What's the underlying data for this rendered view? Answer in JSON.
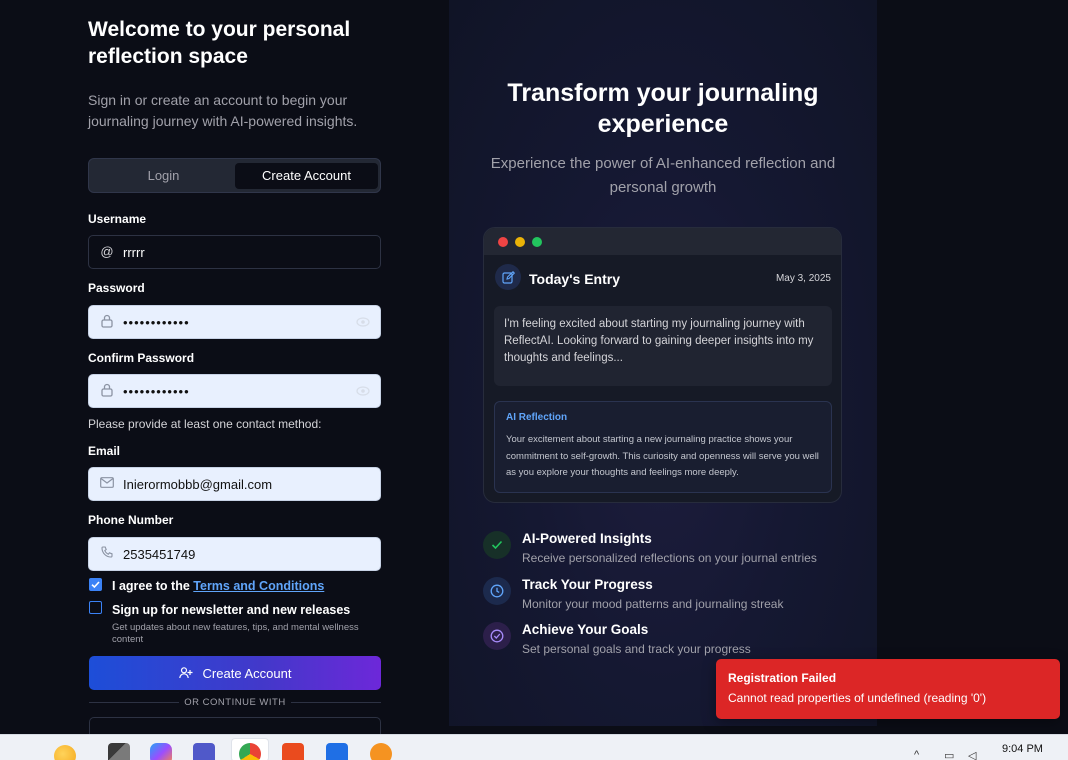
{
  "auth": {
    "welcome_title": "Welcome to your personal reflection space",
    "welcome_subtitle": "Sign in or create an account to begin your journaling journey with AI-powered insights.",
    "tabs": {
      "login": "Login",
      "create": "Create Account"
    },
    "username_label": "Username",
    "username_value": "rrrrr",
    "password_label": "Password",
    "password_value": "••••••••••••",
    "confirm_label": "Confirm Password",
    "confirm_value": "••••••••••••",
    "contact_note": "Please provide at least one contact method:",
    "email_label": "Email",
    "email_value": "Inierormobbb@gmail.com",
    "phone_label": "Phone Number",
    "phone_value": "2535451749",
    "agree_prefix": "I agree to the ",
    "terms_link": "Terms and Conditions",
    "terms_checked": true,
    "newsletter_label": "Sign up for newsletter and new releases",
    "newsletter_checked": false,
    "newsletter_sub": "Get updates about new features, tips, and mental wellness content",
    "submit_label": "Create Account",
    "divider_text": "OR CONTINUE WITH"
  },
  "promo": {
    "title": "Transform your journaling experience",
    "subtitle": "Experience the power of AI-enhanced reflection and personal growth",
    "card": {
      "heading": "Today's Entry",
      "date": "May 3, 2025",
      "entry_text": "I'm feeling excited about starting my journaling journey with ReflectAI. Looking forward to gaining deeper insights into my thoughts and feelings...",
      "ai_title": "AI Reflection",
      "ai_text": "Your excitement about starting a new journaling practice shows your commitment to self-growth. This curiosity and openness will serve you well as you explore your thoughts and feelings more deeply."
    },
    "features": [
      {
        "title": "AI-Powered Insights",
        "desc": "Receive personalized reflections on your journal entries",
        "icon": "check-icon"
      },
      {
        "title": "Track Your Progress",
        "desc": "Monitor your mood patterns and journaling streak",
        "icon": "clock-icon"
      },
      {
        "title": "Achieve Your Goals",
        "desc": "Set personal goals and track your progress",
        "icon": "check-circle-icon"
      }
    ]
  },
  "toast": {
    "title": "Registration Failed",
    "message": "Cannot read properties of undefined (reading '0')"
  },
  "taskbar": {
    "time": "9:04 PM"
  },
  "colors": {
    "accent": "#3b82f6",
    "error": "#dc2626",
    "background": "#0b0d16"
  }
}
